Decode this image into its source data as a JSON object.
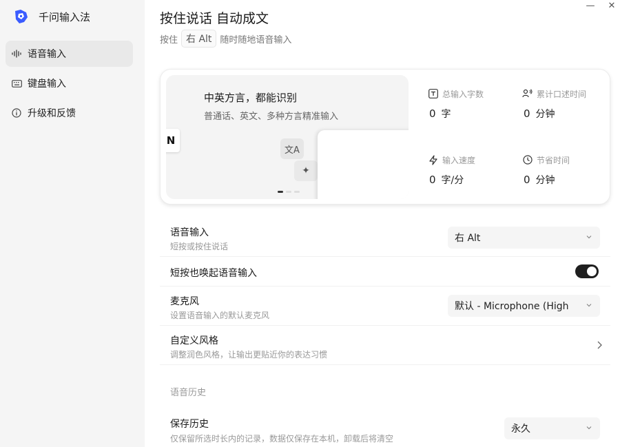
{
  "app": {
    "title": "千问输入法"
  },
  "sidebar": {
    "items": [
      {
        "label": "语音输入",
        "icon": "waveform-icon",
        "active": true
      },
      {
        "label": "键盘输入",
        "icon": "keyboard-icon",
        "active": false
      },
      {
        "label": "升级和反馈",
        "icon": "info-icon",
        "active": false
      }
    ]
  },
  "window": {
    "minimize": "—",
    "close": "✕"
  },
  "header": {
    "title": "按住说话 自动成文",
    "subtitle_prefix": "按住",
    "hotkey": "右 Alt",
    "subtitle_suffix": "随时随地语音输入"
  },
  "banner": {
    "title": "中英方言，都能识别",
    "description": "普通话、英文、多种方言精准输入",
    "chip_text": "文A",
    "chip2_text": "✦"
  },
  "stats": [
    {
      "label": "总输入字数",
      "value": "0",
      "unit": "字",
      "icon": "text-box-icon"
    },
    {
      "label": "累计口述时间",
      "value": "0",
      "unit": "分钟",
      "icon": "speaker-icon"
    },
    {
      "label": "输入速度",
      "value": "0",
      "unit": "字/分",
      "icon": "lightning-icon"
    },
    {
      "label": "节省时间",
      "value": "0",
      "unit": "分钟",
      "icon": "clock-icon"
    }
  ],
  "settings": {
    "voice_input": {
      "title": "语音输入",
      "desc": "短按或按住说话",
      "value": "右 Alt"
    },
    "short_press": {
      "title": "短按也唤起语音输入",
      "enabled": true
    },
    "microphone": {
      "title": "麦克风",
      "desc": "设置语音输入的默认麦克风",
      "value": "默认 - Microphone (High"
    },
    "custom_style": {
      "title": "自定义风格",
      "desc": "调整润色风格，让输出更贴近你的表达习惯"
    },
    "history_section": "语音历史",
    "save_history": {
      "title": "保存历史",
      "desc": "仅保留所选时长内的记录，数据仅保存在本机，卸载后将清空",
      "value": "永久"
    }
  },
  "colors": {
    "accent": "#1f1f1f",
    "logo": "#3b5cff",
    "sidebar_bg": "#f5f5f5"
  }
}
